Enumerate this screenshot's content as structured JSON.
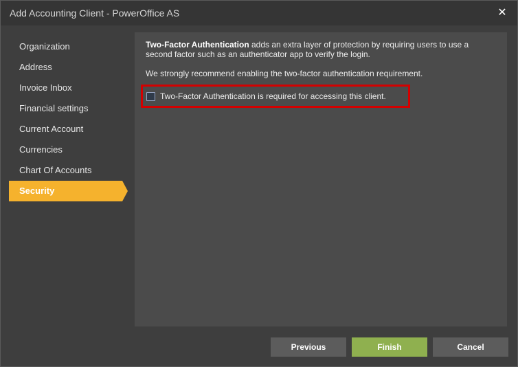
{
  "window": {
    "title": "Add Accounting Client - PowerOffice AS",
    "close_icon": "close-icon"
  },
  "sidebar": {
    "items": [
      {
        "label": "Organization",
        "active": false
      },
      {
        "label": "Address",
        "active": false
      },
      {
        "label": "Invoice Inbox",
        "active": false
      },
      {
        "label": "Financial settings",
        "active": false
      },
      {
        "label": "Current Account",
        "active": false
      },
      {
        "label": "Currencies",
        "active": false
      },
      {
        "label": "Chart Of Accounts",
        "active": false
      },
      {
        "label": "Security",
        "active": true
      }
    ],
    "active_color": "#f5b22d"
  },
  "security": {
    "intro_bold": "Two-Factor Authentication",
    "intro_rest": " adds an extra layer of protection by requiring users to use a second factor such as an authenticator app to verify the login.",
    "recommendation": "We strongly recommend enabling the two-factor authentication requirement.",
    "checkbox_label": "Two-Factor Authentication is required for accessing this client.",
    "checkbox_checked": false,
    "highlight_color": "#d40000"
  },
  "footer": {
    "previous_label": "Previous",
    "finish_label": "Finish",
    "cancel_label": "Cancel",
    "finish_color": "#8fb04f"
  }
}
